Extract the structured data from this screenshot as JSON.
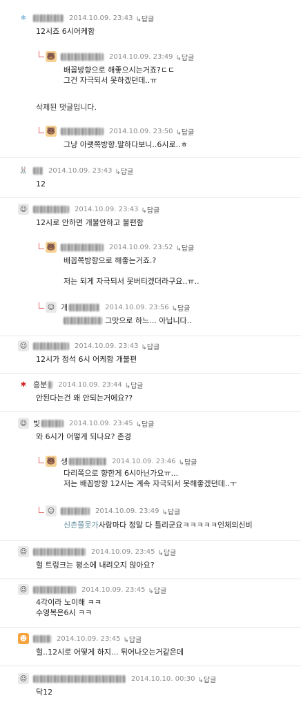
{
  "reply_label": "답글",
  "reply_arrow": "↳",
  "comments": [
    {
      "date": "2014.10.09. 23:43",
      "text": "12시죠 6시어케함",
      "avatar": "snowflake-avatar"
    },
    {
      "date": "2014.10.09. 23:49",
      "text": "배꼽방향으로 해좋으시는거죠?ㄷㄷ\n그건 자극되서 못하겠던데..ㅠ",
      "avatar": "bear-avatar"
    },
    {
      "text": "삭제된 댓글입니다."
    },
    {
      "date": "2014.10.09. 23:50",
      "text": "그냥 아랫쪽방향.말하다보니..6시로..ㅎ",
      "avatar": "bear-avatar"
    },
    {
      "date": "2014.10.09. 23:43",
      "text": "12",
      "avatar": "pink-avatar"
    },
    {
      "date": "2014.10.09. 23:43",
      "text": "12시로 안하면 개불안하고 불편함",
      "avatar": "person-avatar"
    },
    {
      "date": "2014.10.09. 23:52",
      "text": "배꼽쪽방향으로 해좋는거죠.?\n\n저는 되게 자극되서 못버티겠더라구요..ㅠ..",
      "avatar": "bear-avatar"
    },
    {
      "name": "개",
      "date": "2014.10.09. 23:56",
      "quote": "",
      "text": "그맛으로 하느... 아닙니다..",
      "avatar": "person-avatar"
    },
    {
      "date": "2014.10.09. 23:43",
      "text": "12시가 정석 6시 어케함 개불편",
      "avatar": "person-avatar"
    },
    {
      "name": "흥분",
      "date": "2014.10.09. 23:44",
      "text": "안된다는건 왜 안되는거에요??",
      "avatar": "red-avatar"
    },
    {
      "name": "빛",
      "date": "2014.10.09. 23:45",
      "text": "와 6시가 어떻게 되나요? 존경",
      "avatar": "person-avatar"
    },
    {
      "name": "생",
      "date": "2014.10.09. 23:46",
      "text": "다리쪽으로 향한게 6시아닌가요ㅠ...\n저는 배꼽방향 12시는 계속 자극되서 못해좋겠던데..ㅜ",
      "avatar": "bear-avatar"
    },
    {
      "date": "2014.10.09. 23:49",
      "quote": "신촌쫄못가",
      "text": " 사람마다 정말 다 틀리군요ㅋㅋㅋㅋㅋ인체의신비",
      "avatar": "person-avatar"
    },
    {
      "date": "2014.10.09. 23:45",
      "text": "헐 트렁크는 평소에 내려오지 않아요?",
      "avatar": "person-avatar"
    },
    {
      "date": "2014.10.09. 23:45",
      "text": "4각이라 노이해 ㅋㅋ\n수영복은6시 ㅋㅋ",
      "avatar": "person-avatar"
    },
    {
      "date": "2014.10.09. 23:45",
      "text": "헐..12시로 어떻게 하지... 튀어나오는거같은데",
      "avatar": "orange-avatar"
    },
    {
      "date": "2014.10.10. 00:30",
      "text": "닥12",
      "avatar": "person-avatar"
    }
  ]
}
